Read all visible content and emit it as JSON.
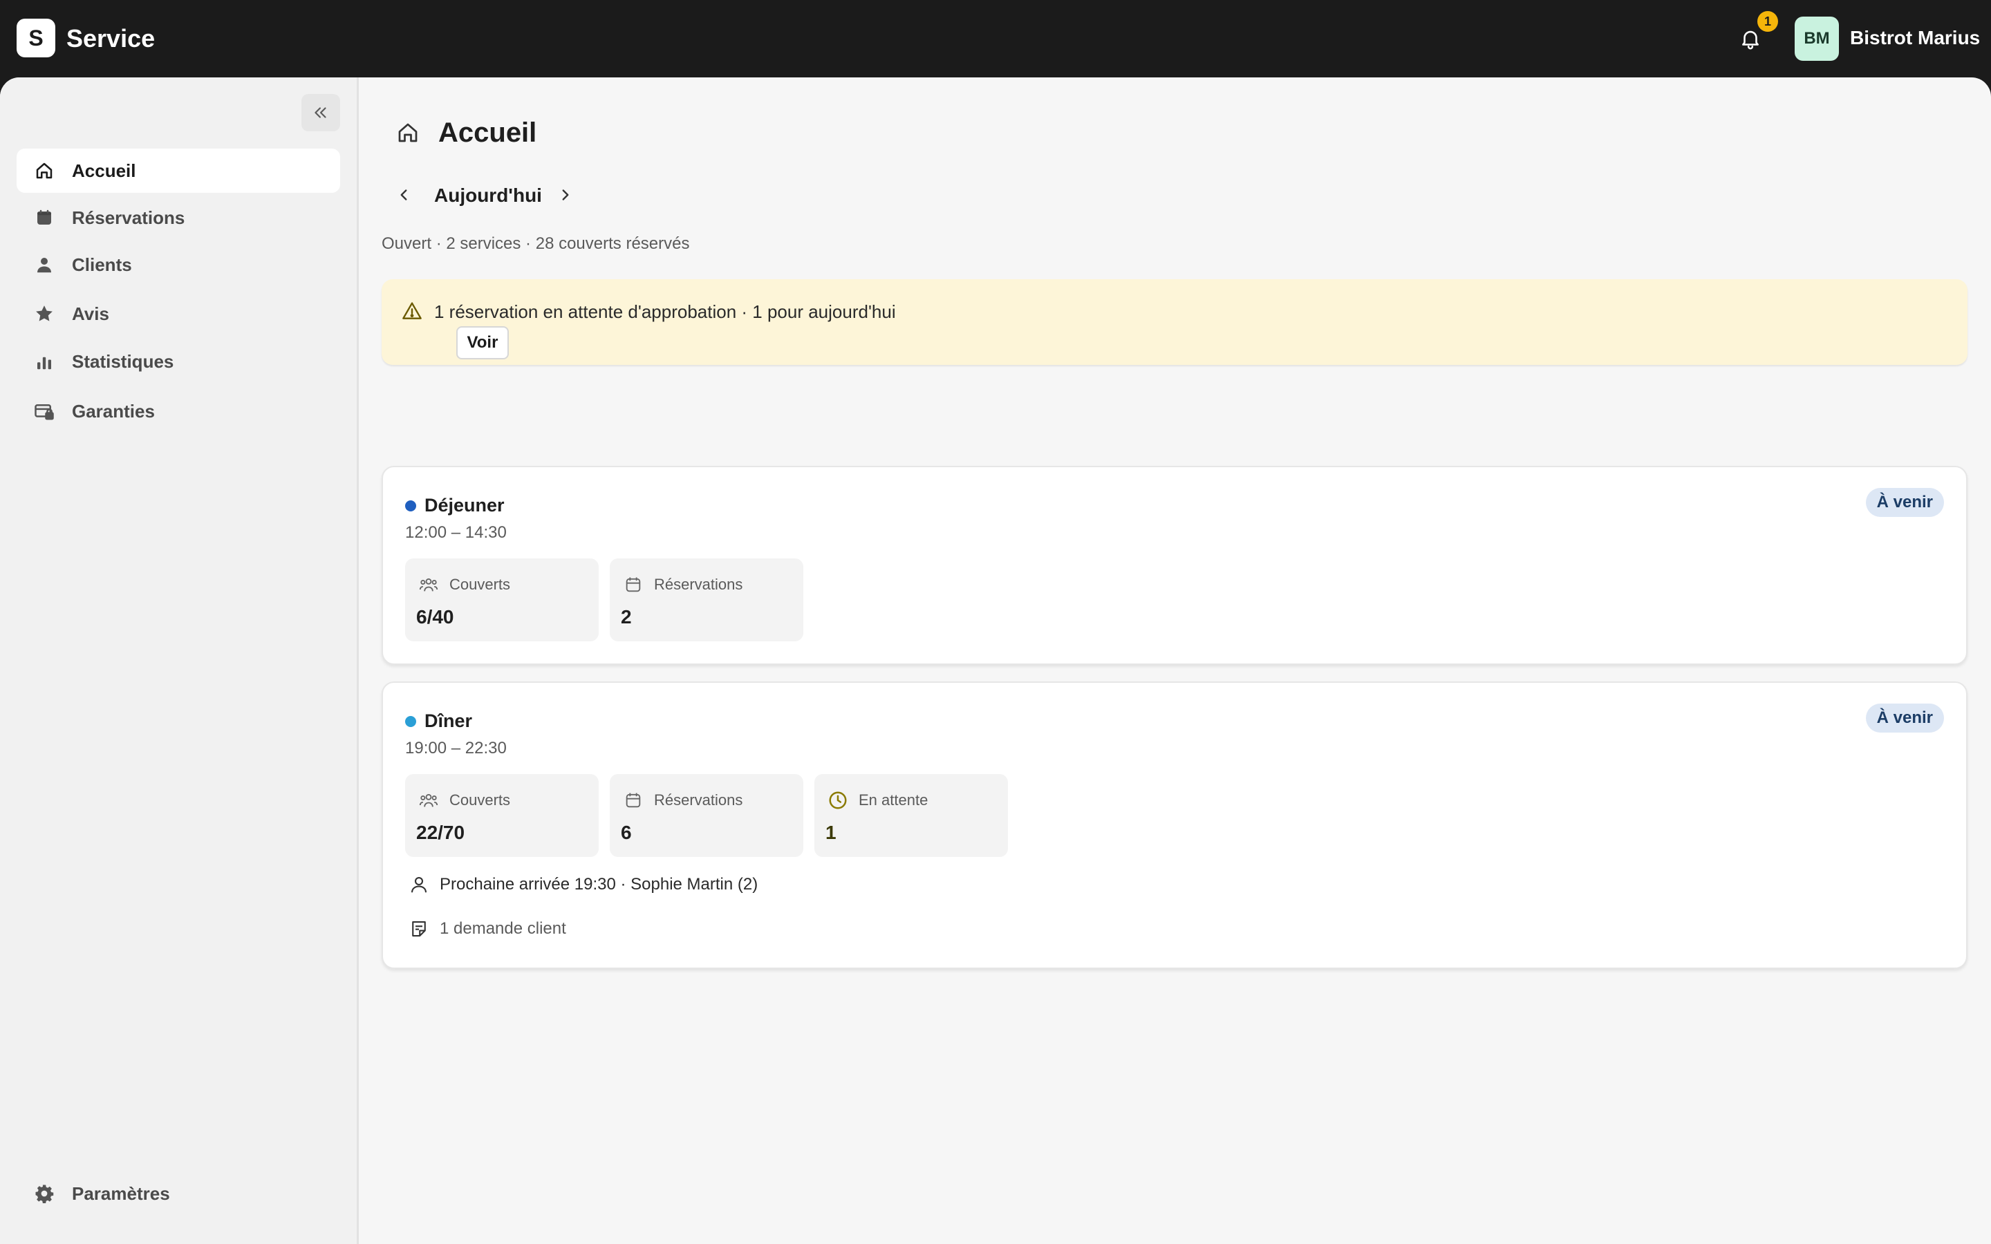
{
  "app": {
    "logo_letter": "S",
    "title": "Service"
  },
  "topbar": {
    "bell_icon": "bell-icon",
    "notification_count": "1",
    "avatar_initials": "BM",
    "account_name": "Bistrot Marius"
  },
  "sidebar": {
    "collapse_icon": "double-chevron-left-icon",
    "items": [
      {
        "label": "Accueil",
        "icon": "home-icon",
        "active": true
      },
      {
        "label": "Réservations",
        "icon": "calendar-icon",
        "active": false
      },
      {
        "label": "Clients",
        "icon": "person-icon",
        "active": false
      },
      {
        "label": "Avis",
        "icon": "star-icon",
        "active": false
      },
      {
        "label": "Statistiques",
        "icon": "bar-chart-icon",
        "active": false
      },
      {
        "label": "Garanties",
        "icon": "card-lock-icon",
        "active": false
      }
    ],
    "settings": {
      "label": "Paramètres",
      "icon": "gear-icon"
    }
  },
  "main": {
    "title": "Accueil",
    "date_label": "Aujourd'hui",
    "summary": "Ouvert · 2 services · 28 couverts réservés",
    "alert": {
      "text": "1 réservation en attente d'approbation · 1 pour aujourd'hui",
      "button_label": "Voir"
    },
    "services": [
      {
        "name": "Déjeuner",
        "time": "12:00 – 14:30",
        "status": "À venir",
        "dot_color": "#1f5fbf",
        "stats": [
          {
            "label": "Couverts",
            "value": "6/40",
            "icon": "people-icon"
          },
          {
            "label": "Réservations",
            "value": "2",
            "icon": "calendar-icon"
          }
        ]
      },
      {
        "name": "Dîner",
        "time": "19:00 – 22:30",
        "status": "À venir",
        "dot_color": "#2a9fd6",
        "stats": [
          {
            "label": "Couverts",
            "value": "22/70",
            "icon": "people-icon"
          },
          {
            "label": "Réservations",
            "value": "6",
            "icon": "calendar-icon"
          },
          {
            "label": "En attente",
            "value": "1",
            "icon": "clock-icon"
          }
        ],
        "next_arrival": "Prochaine arrivée 19:30 · Sophie Martin (2)",
        "requests": "1 demande client"
      }
    ]
  },
  "colors": {
    "topbar": "#1b1b1b",
    "alert_bg": "#fdf5d8",
    "badge_bg": "#dde7f5",
    "notification_badge": "#f5b50a",
    "avatar_bg": "#c9f2df"
  }
}
